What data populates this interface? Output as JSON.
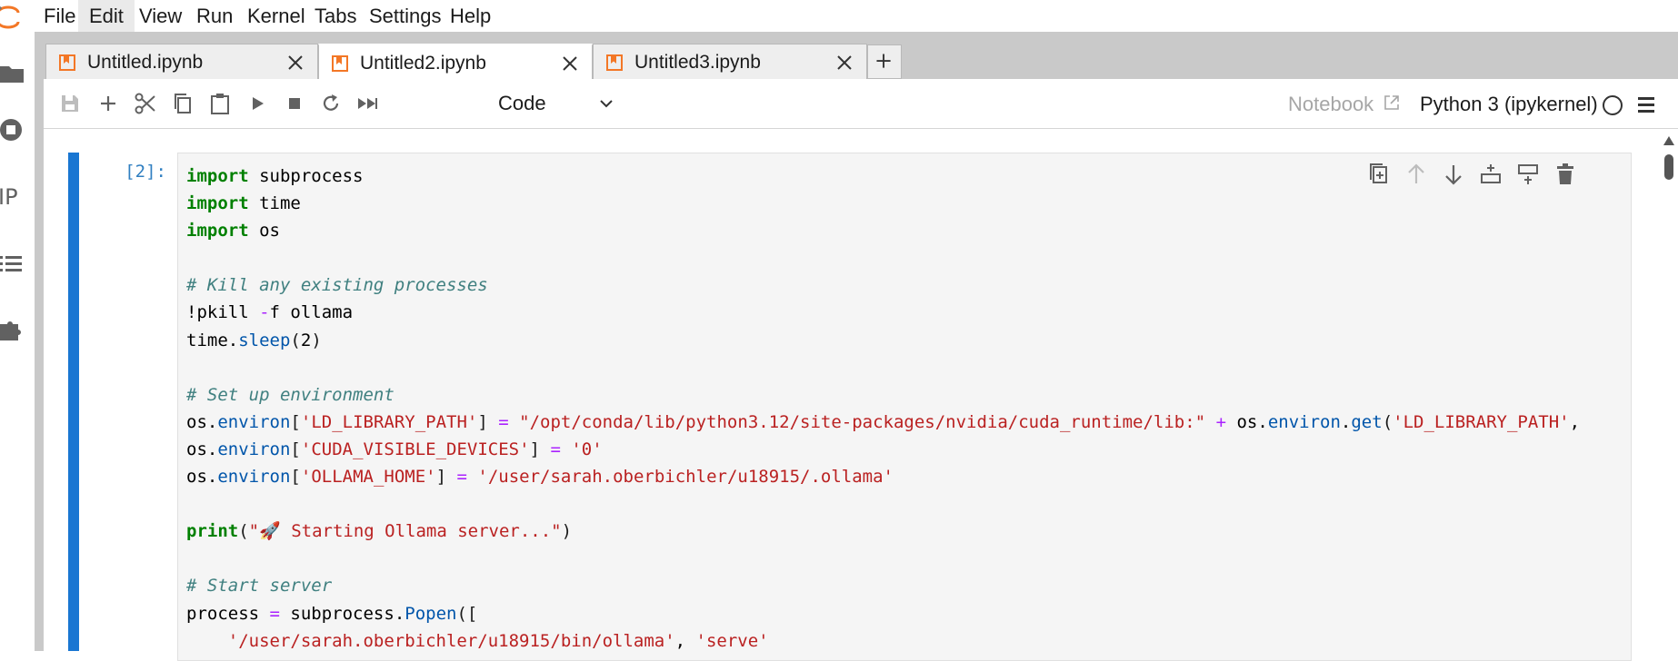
{
  "menubar": {
    "items": [
      {
        "label": "File",
        "active": false
      },
      {
        "label": "Edit",
        "active": true
      },
      {
        "label": "View",
        "active": false
      },
      {
        "label": "Run",
        "active": false
      },
      {
        "label": "Kernel",
        "active": false
      },
      {
        "label": "Tabs",
        "active": false
      },
      {
        "label": "Settings",
        "active": false
      },
      {
        "label": "Help",
        "active": false
      }
    ]
  },
  "leftbar": {
    "icons": [
      "folder-icon",
      "running-icon",
      "property-inspector-icon",
      "table-of-contents-icon",
      "extension-icon"
    ],
    "partial_label": "IP"
  },
  "tabs": [
    {
      "label": "Untitled.ipynb",
      "active": false
    },
    {
      "label": "Untitled2.ipynb",
      "active": true
    },
    {
      "label": "Untitled3.ipynb",
      "active": false
    }
  ],
  "toolbar": {
    "cell_type": "Code",
    "notebook_label": "Notebook",
    "kernel_name": "Python 3 (ipykernel)"
  },
  "cell": {
    "prompt": "[2]:",
    "code_lines": [
      [
        {
          "t": "import",
          "c": "kw"
        },
        {
          "t": " subprocess",
          "c": ""
        }
      ],
      [
        {
          "t": "import",
          "c": "kw"
        },
        {
          "t": " time",
          "c": ""
        }
      ],
      [
        {
          "t": "import",
          "c": "kw"
        },
        {
          "t": " os",
          "c": ""
        }
      ],
      [],
      [
        {
          "t": "# Kill any existing processes",
          "c": "cm"
        }
      ],
      [
        {
          "t": "!pkill ",
          "c": ""
        },
        {
          "t": "-",
          "c": "op"
        },
        {
          "t": "f ollama",
          "c": ""
        }
      ],
      [
        {
          "t": "time",
          "c": ""
        },
        {
          "t": ".",
          "c": ""
        },
        {
          "t": "sleep",
          "c": "fn"
        },
        {
          "t": "(",
          "c": "br"
        },
        {
          "t": "2",
          "c": ""
        },
        {
          "t": ")",
          "c": "br"
        }
      ],
      [],
      [
        {
          "t": "# Set up environment",
          "c": "cm"
        }
      ],
      [
        {
          "t": "os",
          "c": ""
        },
        {
          "t": ".",
          "c": ""
        },
        {
          "t": "environ",
          "c": "fn"
        },
        {
          "t": "[",
          "c": "br"
        },
        {
          "t": "'LD_LIBRARY_PATH'",
          "c": "st"
        },
        {
          "t": "]",
          "c": "br"
        },
        {
          "t": " ",
          "c": ""
        },
        {
          "t": "=",
          "c": "op"
        },
        {
          "t": " ",
          "c": ""
        },
        {
          "t": "\"/opt/conda/lib/python3.12/site-packages/nvidia/cuda_runtime/lib:\"",
          "c": "st"
        },
        {
          "t": " ",
          "c": ""
        },
        {
          "t": "+",
          "c": "op"
        },
        {
          "t": " os",
          "c": ""
        },
        {
          "t": ".",
          "c": ""
        },
        {
          "t": "environ",
          "c": "fn"
        },
        {
          "t": ".",
          "c": ""
        },
        {
          "t": "get",
          "c": "fn"
        },
        {
          "t": "(",
          "c": "br"
        },
        {
          "t": "'LD_LIBRARY_PATH'",
          "c": "st"
        },
        {
          "t": ",",
          "c": ""
        }
      ],
      [
        {
          "t": "os",
          "c": ""
        },
        {
          "t": ".",
          "c": ""
        },
        {
          "t": "environ",
          "c": "fn"
        },
        {
          "t": "[",
          "c": "br"
        },
        {
          "t": "'CUDA_VISIBLE_DEVICES'",
          "c": "st"
        },
        {
          "t": "]",
          "c": "br"
        },
        {
          "t": " ",
          "c": ""
        },
        {
          "t": "=",
          "c": "op"
        },
        {
          "t": " ",
          "c": ""
        },
        {
          "t": "'0'",
          "c": "st"
        }
      ],
      [
        {
          "t": "os",
          "c": ""
        },
        {
          "t": ".",
          "c": ""
        },
        {
          "t": "environ",
          "c": "fn"
        },
        {
          "t": "[",
          "c": "br"
        },
        {
          "t": "'OLLAMA_HOME'",
          "c": "st"
        },
        {
          "t": "]",
          "c": "br"
        },
        {
          "t": " ",
          "c": ""
        },
        {
          "t": "=",
          "c": "op"
        },
        {
          "t": " ",
          "c": ""
        },
        {
          "t": "'/user/sarah.oberbichler/u18915/.ollama'",
          "c": "st"
        }
      ],
      [],
      [
        {
          "t": "print",
          "c": "kw"
        },
        {
          "t": "(",
          "c": "br"
        },
        {
          "t": "\"🚀 Starting Ollama server...\"",
          "c": "st"
        },
        {
          "t": ")",
          "c": "br"
        }
      ],
      [],
      [
        {
          "t": "# Start server",
          "c": "cm"
        }
      ],
      [
        {
          "t": "process",
          "c": ""
        },
        {
          "t": " ",
          "c": ""
        },
        {
          "t": "=",
          "c": "op"
        },
        {
          "t": " subprocess",
          "c": ""
        },
        {
          "t": ".",
          "c": ""
        },
        {
          "t": "Popen",
          "c": "fn"
        },
        {
          "t": "([",
          "c": "br"
        }
      ],
      [
        {
          "t": "    ",
          "c": ""
        },
        {
          "t": "'/user/sarah.oberbichler/u18915/bin/ollama'",
          "c": "st"
        },
        {
          "t": ", ",
          "c": ""
        },
        {
          "t": "'serve'",
          "c": "st"
        }
      ]
    ]
  },
  "cell_toolbar": {
    "buttons": [
      "duplicate-cell-icon",
      "move-up-icon",
      "move-down-icon",
      "insert-above-icon",
      "insert-below-icon",
      "delete-cell-icon"
    ]
  },
  "colors": {
    "accent": "#1976d2",
    "tab_icon": "#f37726",
    "keyword": "#008000",
    "comment": "#408080",
    "string": "#ba2121",
    "prompt": "#307fc1"
  }
}
